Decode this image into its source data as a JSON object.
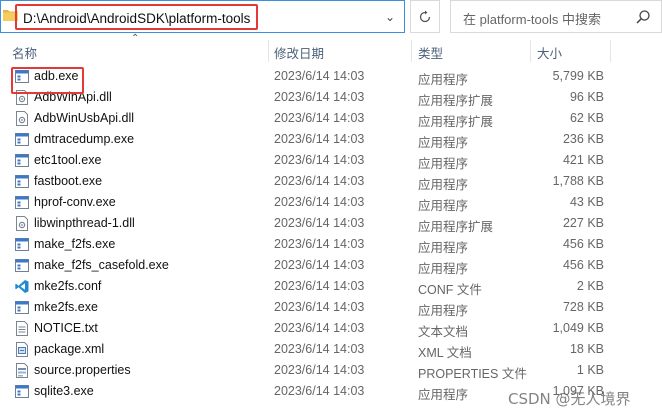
{
  "address_bar": {
    "path": "D:\\Android\\AndroidSDK\\platform-tools"
  },
  "search": {
    "placeholder": "在 platform-tools 中搜索"
  },
  "columns": {
    "name": "名称",
    "date": "修改日期",
    "type": "类型",
    "size": "大小"
  },
  "files": [
    {
      "name": "adb.exe",
      "date": "2023/6/14 14:03",
      "type": "应用程序",
      "size": "5,799 KB",
      "icon": "exe-icon"
    },
    {
      "name": "AdbWinApi.dll",
      "date": "2023/6/14 14:03",
      "type": "应用程序扩展",
      "size": "96 KB",
      "icon": "dll-icon"
    },
    {
      "name": "AdbWinUsbApi.dll",
      "date": "2023/6/14 14:03",
      "type": "应用程序扩展",
      "size": "62 KB",
      "icon": "dll-icon"
    },
    {
      "name": "dmtracedump.exe",
      "date": "2023/6/14 14:03",
      "type": "应用程序",
      "size": "236 KB",
      "icon": "exe-icon"
    },
    {
      "name": "etc1tool.exe",
      "date": "2023/6/14 14:03",
      "type": "应用程序",
      "size": "421 KB",
      "icon": "exe-icon"
    },
    {
      "name": "fastboot.exe",
      "date": "2023/6/14 14:03",
      "type": "应用程序",
      "size": "1,788 KB",
      "icon": "exe-icon"
    },
    {
      "name": "hprof-conv.exe",
      "date": "2023/6/14 14:03",
      "type": "应用程序",
      "size": "43 KB",
      "icon": "exe-icon"
    },
    {
      "name": "libwinpthread-1.dll",
      "date": "2023/6/14 14:03",
      "type": "应用程序扩展",
      "size": "227 KB",
      "icon": "dll-icon"
    },
    {
      "name": "make_f2fs.exe",
      "date": "2023/6/14 14:03",
      "type": "应用程序",
      "size": "456 KB",
      "icon": "exe-icon"
    },
    {
      "name": "make_f2fs_casefold.exe",
      "date": "2023/6/14 14:03",
      "type": "应用程序",
      "size": "456 KB",
      "icon": "exe-icon"
    },
    {
      "name": "mke2fs.conf",
      "date": "2023/6/14 14:03",
      "type": "CONF 文件",
      "size": "2 KB",
      "icon": "vscode-icon"
    },
    {
      "name": "mke2fs.exe",
      "date": "2023/6/14 14:03",
      "type": "应用程序",
      "size": "728 KB",
      "icon": "exe-icon"
    },
    {
      "name": "NOTICE.txt",
      "date": "2023/6/14 14:03",
      "type": "文本文档",
      "size": "1,049 KB",
      "icon": "txt-icon"
    },
    {
      "name": "package.xml",
      "date": "2023/6/14 14:03",
      "type": "XML 文档",
      "size": "18 KB",
      "icon": "xml-icon"
    },
    {
      "name": "source.properties",
      "date": "2023/6/14 14:03",
      "type": "PROPERTIES 文件",
      "size": "1 KB",
      "icon": "properties-icon"
    },
    {
      "name": "sqlite3.exe",
      "date": "2023/6/14 14:03",
      "type": "应用程序",
      "size": "1,097 KB",
      "icon": "exe-icon"
    }
  ],
  "watermark": "CSDN @无人境界",
  "colors": {
    "selection_border": "#e53935",
    "address_border": "#3d8fdc",
    "header_text": "#4c607a"
  }
}
